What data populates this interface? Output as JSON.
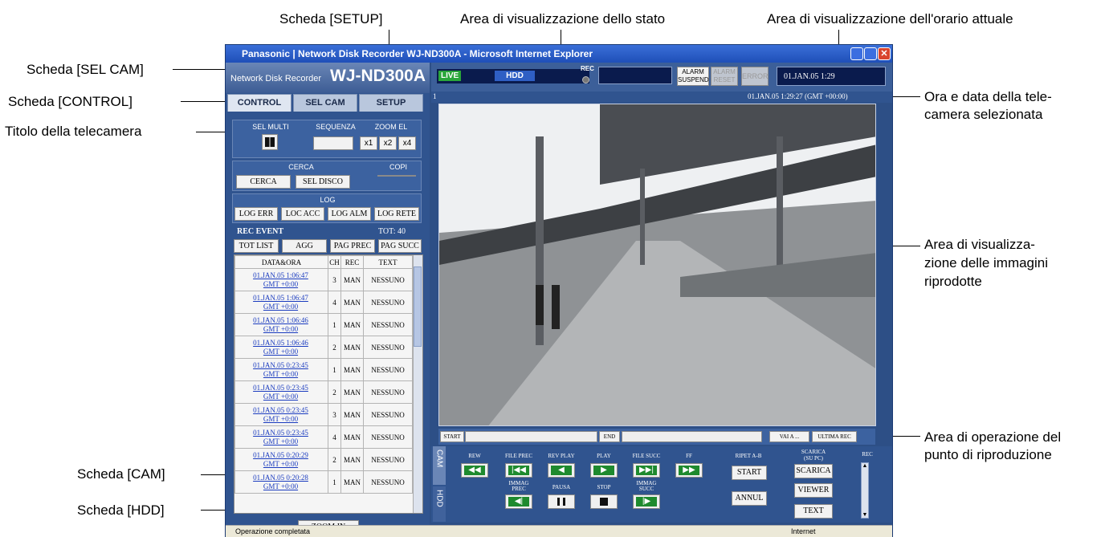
{
  "callouts": {
    "setup_tab": "Scheda [SETUP]",
    "status_area": "Area di visualizzazione dello stato",
    "time_area": "Area di visualizzazione dell'orario attuale",
    "sel_cam_tab": "Scheda [SEL CAM]",
    "control_tab": "Scheda [CONTROL]",
    "camera_title": "Titolo della telecamera",
    "cam_datetime_1": "Ora e data della tele-",
    "cam_datetime_2": "camera selezionata",
    "image_area_1": "Area di visualizza-",
    "image_area_2": "zione delle immagini",
    "image_area_3": "riprodotte",
    "playback_area_1": "Area di operazione del",
    "playback_area_2": "punto di riproduzione",
    "cam_tab": "Scheda [CAM]",
    "hdd_tab": "Scheda [HDD]"
  },
  "window": {
    "title": "Panasonic | Network Disk Recorder WJ-ND300A - Microsoft Internet Explorer",
    "brand_small": "Network Disk Recorder",
    "brand_model": "WJ-ND300A"
  },
  "tabs": {
    "control": "CONTROL",
    "sel_cam": "SEL CAM",
    "setup": "SETUP"
  },
  "control": {
    "sel_multi": "SEL MULTI",
    "sequenza": "SEQUENZA",
    "zoom_el": "ZOOM EL",
    "zoom_x1": "x1",
    "zoom_x2": "x2",
    "zoom_x4": "x4",
    "cerca_label": "CERCA",
    "cerca_btn": "CERCA",
    "sel_disco": "SEL DISCO",
    "copi": "COPI",
    "log": "LOG",
    "log_err": "LOG ERR",
    "loc_acc": "LOC ACC",
    "log_alm": "LOG ALM",
    "log_rete": "LOG RETE",
    "rec_event": "REC EVENT",
    "tot": "TOT: 40",
    "tot_list": "TOT LIST",
    "agg": "AGG",
    "pag_prec": "PAG PREC",
    "pag_succ": "PAG SUCC",
    "zoom_in": "ZOOM IN"
  },
  "event_table": {
    "headers": [
      "DATA&ORA",
      "CH",
      "REC",
      "TEXT"
    ],
    "rows": [
      {
        "date": "01.JAN.05  1:06:47",
        "gmt": "GMT +0:00",
        "ch": "3",
        "rec": "MAN",
        "text": "NESSUNO"
      },
      {
        "date": "01.JAN.05  1:06:47",
        "gmt": "GMT +0:00",
        "ch": "4",
        "rec": "MAN",
        "text": "NESSUNO"
      },
      {
        "date": "01.JAN.05  1:06:46",
        "gmt": "GMT +0:00",
        "ch": "1",
        "rec": "MAN",
        "text": "NESSUNO"
      },
      {
        "date": "01.JAN.05  1:06:46",
        "gmt": "GMT +0:00",
        "ch": "2",
        "rec": "MAN",
        "text": "NESSUNO"
      },
      {
        "date": "01.JAN.05  0:23:45",
        "gmt": "GMT +0:00",
        "ch": "1",
        "rec": "MAN",
        "text": "NESSUNO"
      },
      {
        "date": "01.JAN.05  0:23:45",
        "gmt": "GMT +0:00",
        "ch": "2",
        "rec": "MAN",
        "text": "NESSUNO"
      },
      {
        "date": "01.JAN.05  0:23:45",
        "gmt": "GMT +0:00",
        "ch": "3",
        "rec": "MAN",
        "text": "NESSUNO"
      },
      {
        "date": "01.JAN.05  0:23:45",
        "gmt": "GMT +0:00",
        "ch": "4",
        "rec": "MAN",
        "text": "NESSUNO"
      },
      {
        "date": "01.JAN.05  0:20:29",
        "gmt": "GMT +0:00",
        "ch": "2",
        "rec": "MAN",
        "text": "NESSUNO"
      },
      {
        "date": "01.JAN.05  0:20:28",
        "gmt": "GMT +0:00",
        "ch": "1",
        "rec": "MAN",
        "text": "NESSUNO"
      }
    ]
  },
  "status": {
    "live": "LIVE",
    "hdd": "HDD",
    "rec": "REC",
    "alarm_suspend_1": "ALARM",
    "alarm_suspend_2": "SUSPEND",
    "alarm_reset_1": "ALARM",
    "alarm_reset_2": "RESET",
    "error": "ERROR",
    "clock": "01.JAN.05   1:29"
  },
  "camera": {
    "title": "1",
    "datetime": "01.JAN.05   1:29:27 (GMT +00:00)"
  },
  "position": {
    "start": "START",
    "end": "END",
    "vai_a": "VAI A ...",
    "ultima_rec": "ULTIMA REC"
  },
  "side_tabs": {
    "cam": "CAM",
    "hdd": "HDD"
  },
  "playback": {
    "rew": "REW",
    "file_prec": "FILE PREC",
    "rev_play": "REV PLAY",
    "play": "PLAY",
    "file_succ": "FILE SUCC",
    "ff": "FF",
    "immag_prec_1": "IMMAG",
    "immag_prec_2": "PREC",
    "pausa": "PAUSA",
    "stop": "STOP",
    "immag_succ_1": "IMMAG",
    "immag_succ_2": "SUCC",
    "ripet_ab": "RIPET A-B",
    "start": "START",
    "annul": "ANNUL",
    "scarica_label_1": "SCARICA",
    "scarica_label_2": "(SU PC)",
    "scarica": "SCARICA",
    "viewer": "VIEWER",
    "text": "TEXT",
    "rec": "REC"
  },
  "statusbar": {
    "left": "Operazione completata",
    "right": "Internet"
  }
}
